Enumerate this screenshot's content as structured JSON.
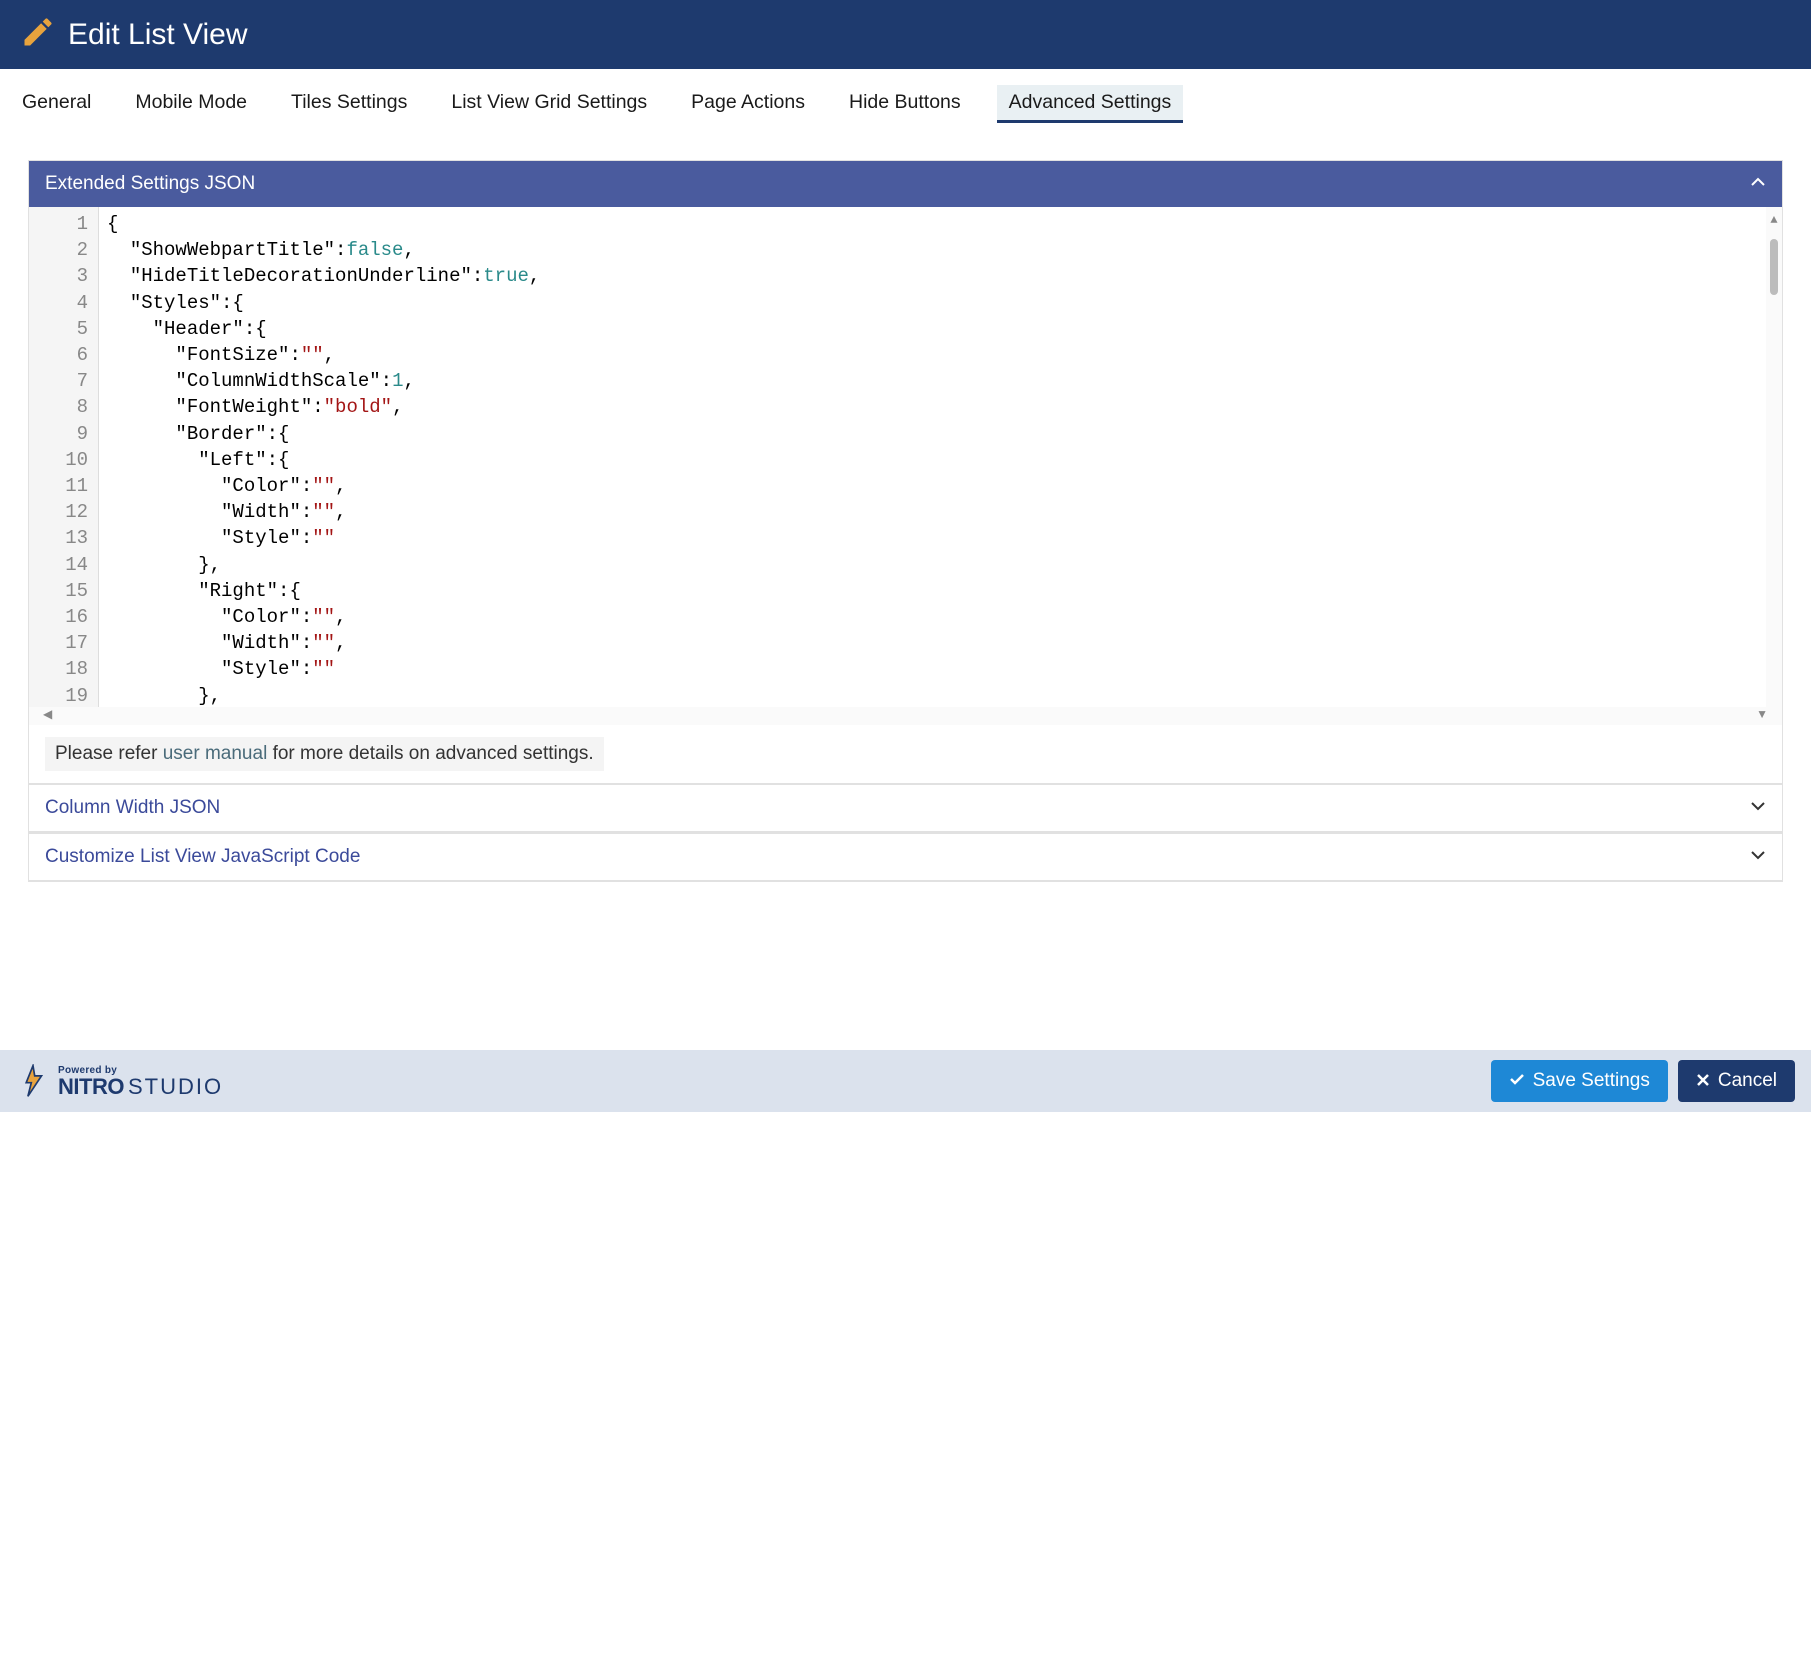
{
  "header": {
    "title": "Edit List View"
  },
  "tabs": {
    "items": [
      {
        "label": "General"
      },
      {
        "label": "Mobile Mode"
      },
      {
        "label": "Tiles Settings"
      },
      {
        "label": "List View Grid Settings"
      },
      {
        "label": "Page Actions"
      },
      {
        "label": "Hide Buttons"
      },
      {
        "label": "Advanced Settings"
      }
    ],
    "active_index": 6
  },
  "panels": {
    "extended": {
      "title": "Extended Settings JSON",
      "expanded": true,
      "code_lines": [
        {
          "indent": 0,
          "tokens": [
            {
              "t": "punc",
              "v": "{"
            }
          ]
        },
        {
          "indent": 1,
          "tokens": [
            {
              "t": "key",
              "v": "\"ShowWebpartTitle\""
            },
            {
              "t": "punc",
              "v": ":"
            },
            {
              "t": "bool",
              "v": "false"
            },
            {
              "t": "punc",
              "v": ","
            }
          ]
        },
        {
          "indent": 1,
          "tokens": [
            {
              "t": "key",
              "v": "\"HideTitleDecorationUnderline\""
            },
            {
              "t": "punc",
              "v": ":"
            },
            {
              "t": "bool",
              "v": "true"
            },
            {
              "t": "punc",
              "v": ","
            }
          ]
        },
        {
          "indent": 1,
          "tokens": [
            {
              "t": "key",
              "v": "\"Styles\""
            },
            {
              "t": "punc",
              "v": ":{"
            }
          ]
        },
        {
          "indent": 2,
          "tokens": [
            {
              "t": "key",
              "v": "\"Header\""
            },
            {
              "t": "punc",
              "v": ":{"
            }
          ]
        },
        {
          "indent": 3,
          "tokens": [
            {
              "t": "key",
              "v": "\"FontSize\""
            },
            {
              "t": "punc",
              "v": ":"
            },
            {
              "t": "str",
              "v": "\"\""
            },
            {
              "t": "punc",
              "v": ","
            }
          ]
        },
        {
          "indent": 3,
          "tokens": [
            {
              "t": "key",
              "v": "\"ColumnWidthScale\""
            },
            {
              "t": "punc",
              "v": ":"
            },
            {
              "t": "num",
              "v": "1"
            },
            {
              "t": "punc",
              "v": ","
            }
          ]
        },
        {
          "indent": 3,
          "tokens": [
            {
              "t": "key",
              "v": "\"FontWeight\""
            },
            {
              "t": "punc",
              "v": ":"
            },
            {
              "t": "str",
              "v": "\"bold\""
            },
            {
              "t": "punc",
              "v": ","
            }
          ]
        },
        {
          "indent": 3,
          "tokens": [
            {
              "t": "key",
              "v": "\"Border\""
            },
            {
              "t": "punc",
              "v": ":{"
            }
          ]
        },
        {
          "indent": 4,
          "tokens": [
            {
              "t": "key",
              "v": "\"Left\""
            },
            {
              "t": "punc",
              "v": ":{"
            }
          ]
        },
        {
          "indent": 5,
          "tokens": [
            {
              "t": "key",
              "v": "\"Color\""
            },
            {
              "t": "punc",
              "v": ":"
            },
            {
              "t": "str",
              "v": "\"\""
            },
            {
              "t": "punc",
              "v": ","
            }
          ]
        },
        {
          "indent": 5,
          "tokens": [
            {
              "t": "key",
              "v": "\"Width\""
            },
            {
              "t": "punc",
              "v": ":"
            },
            {
              "t": "str",
              "v": "\"\""
            },
            {
              "t": "punc",
              "v": ","
            }
          ]
        },
        {
          "indent": 5,
          "tokens": [
            {
              "t": "key",
              "v": "\"Style\""
            },
            {
              "t": "punc",
              "v": ":"
            },
            {
              "t": "str",
              "v": "\"\""
            }
          ]
        },
        {
          "indent": 4,
          "tokens": [
            {
              "t": "punc",
              "v": "},"
            }
          ]
        },
        {
          "indent": 4,
          "tokens": [
            {
              "t": "key",
              "v": "\"Right\""
            },
            {
              "t": "punc",
              "v": ":{"
            }
          ]
        },
        {
          "indent": 5,
          "tokens": [
            {
              "t": "key",
              "v": "\"Color\""
            },
            {
              "t": "punc",
              "v": ":"
            },
            {
              "t": "str",
              "v": "\"\""
            },
            {
              "t": "punc",
              "v": ","
            }
          ]
        },
        {
          "indent": 5,
          "tokens": [
            {
              "t": "key",
              "v": "\"Width\""
            },
            {
              "t": "punc",
              "v": ":"
            },
            {
              "t": "str",
              "v": "\"\""
            },
            {
              "t": "punc",
              "v": ","
            }
          ]
        },
        {
          "indent": 5,
          "tokens": [
            {
              "t": "key",
              "v": "\"Style\""
            },
            {
              "t": "punc",
              "v": ":"
            },
            {
              "t": "str",
              "v": "\"\""
            }
          ]
        },
        {
          "indent": 4,
          "tokens": [
            {
              "t": "punc",
              "v": "},"
            }
          ]
        }
      ],
      "help_prefix": "Please refer ",
      "help_link_text": "user manual",
      "help_suffix": " for more details on advanced settings."
    },
    "column_width": {
      "title": "Column Width JSON",
      "expanded": false
    },
    "customize_js": {
      "title": "Customize List View JavaScript Code",
      "expanded": false
    }
  },
  "footer": {
    "powered_by": "Powered by",
    "brand": "NITRO",
    "brand_sub": "STUDIO",
    "save_label": "Save Settings",
    "cancel_label": "Cancel"
  }
}
